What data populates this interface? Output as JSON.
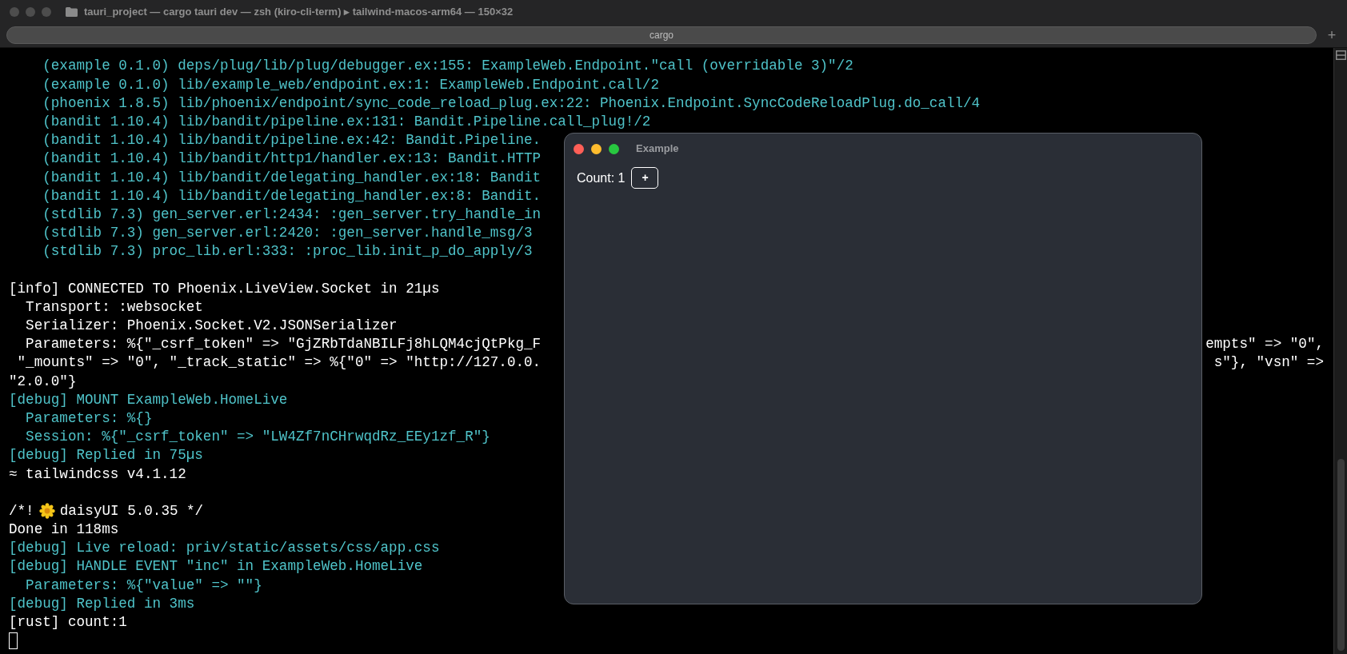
{
  "terminal_window": {
    "title": "tauri_project — cargo tauri dev — zsh (kiro-cli-term) ▸ tailwind-macos-arm64 — 150×32",
    "tabs": [
      {
        "label": "cargo",
        "selected": true
      }
    ],
    "new_tab": "+"
  },
  "lines": [
    {
      "kind": "text",
      "color": "#4fc3c9",
      "text": "    (example 0.1.0) deps/plug/lib/plug/debugger.ex:155: ExampleWeb.Endpoint.\"call (overridable 3)\"/2"
    },
    {
      "kind": "text",
      "color": "#4fc3c9",
      "text": "    (example 0.1.0) lib/example_web/endpoint.ex:1: ExampleWeb.Endpoint.call/2"
    },
    {
      "kind": "text",
      "color": "#4fc3c9",
      "text": "    (phoenix 1.8.5) lib/phoenix/endpoint/sync_code_reload_plug.ex:22: Phoenix.Endpoint.SyncCodeReloadPlug.do_call/4"
    },
    {
      "kind": "text",
      "color": "#4fc3c9",
      "text": "    (bandit 1.10.4) lib/bandit/pipeline.ex:131: Bandit.Pipeline.call_plug!/2"
    },
    {
      "kind": "text",
      "color": "#4fc3c9",
      "text": "    (bandit 1.10.4) lib/bandit/pipeline.ex:42: Bandit.Pipeline."
    },
    {
      "kind": "text",
      "color": "#4fc3c9",
      "text": "    (bandit 1.10.4) lib/bandit/http1/handler.ex:13: Bandit.HTTP"
    },
    {
      "kind": "text",
      "color": "#4fc3c9",
      "text": "    (bandit 1.10.4) lib/bandit/delegating_handler.ex:18: Bandit"
    },
    {
      "kind": "text",
      "color": "#4fc3c9",
      "text": "    (bandit 1.10.4) lib/bandit/delegating_handler.ex:8: Bandit."
    },
    {
      "kind": "text",
      "color": "#4fc3c9",
      "text": "    (stdlib 7.3) gen_server.erl:2434: :gen_server.try_handle_in"
    },
    {
      "kind": "text",
      "color": "#4fc3c9",
      "text": "    (stdlib 7.3) gen_server.erl:2420: :gen_server.handle_msg/3"
    },
    {
      "kind": "text",
      "color": "#4fc3c9",
      "text": "    (stdlib 7.3) proc_lib.erl:333: :proc_lib.init_p_do_apply/3"
    },
    {
      "kind": "blank"
    },
    {
      "kind": "text",
      "color": "#ffffff",
      "text": "[info] CONNECTED TO Phoenix.LiveView.Socket in 21µs"
    },
    {
      "kind": "text",
      "color": "#ffffff",
      "text": "  Transport: :websocket"
    },
    {
      "kind": "text",
      "color": "#ffffff",
      "text": "  Serializer: Phoenix.Socket.V2.JSONSerializer"
    },
    {
      "kind": "text",
      "color": "#ffffff",
      "text": "  Parameters: %{\"_csrf_token\" => \"GjZRbTdaNBILFj8hLQM4cjQtPkg_F",
      "right": "empts\" => \"0\","
    },
    {
      "kind": "text",
      "color": "#ffffff",
      "text": " \"_mounts\" => \"0\", \"_track_static\" => %{\"0\" => \"http://127.0.0.",
      "right": "s\"}, \"vsn\" =>"
    },
    {
      "kind": "text",
      "color": "#ffffff",
      "text": "\"2.0.0\"}"
    },
    {
      "kind": "text",
      "color": "#4fc3c9",
      "text": "[debug] MOUNT ExampleWeb.HomeLive"
    },
    {
      "kind": "text",
      "color": "#4fc3c9",
      "text": "  Parameters: %{}"
    },
    {
      "kind": "text",
      "color": "#4fc3c9",
      "text": "  Session: %{\"_csrf_token\" => \"LW4Zf7nCHrwqdRz_EEy1zf_R\"}"
    },
    {
      "kind": "text",
      "color": "#4fc3c9",
      "text": "[debug] Replied in 75µs"
    },
    {
      "kind": "text",
      "color": "#ffffff",
      "text": "≈ tailwindcss v4.1.12"
    },
    {
      "kind": "blank"
    },
    {
      "kind": "flower",
      "color": "#ffffff",
      "before": "/*!",
      "after": "daisyUI 5.0.35 */"
    },
    {
      "kind": "text",
      "color": "#ffffff",
      "text": "Done in 118ms"
    },
    {
      "kind": "text",
      "color": "#4fc3c9",
      "text": "[debug] Live reload: priv/static/assets/css/app.css"
    },
    {
      "kind": "text",
      "color": "#4fc3c9",
      "text": "[debug] HANDLE EVENT \"inc\" in ExampleWeb.HomeLive"
    },
    {
      "kind": "text",
      "color": "#4fc3c9",
      "text": "  Parameters: %{\"value\" => \"\"}"
    },
    {
      "kind": "text",
      "color": "#4fc3c9",
      "text": "[debug] Replied in 3ms"
    },
    {
      "kind": "text",
      "color": "#ffffff",
      "text": "[rust] count:1"
    },
    {
      "kind": "cursor"
    }
  ],
  "app_window": {
    "title": "Example",
    "count_label": "Count: 1",
    "button": "+"
  }
}
